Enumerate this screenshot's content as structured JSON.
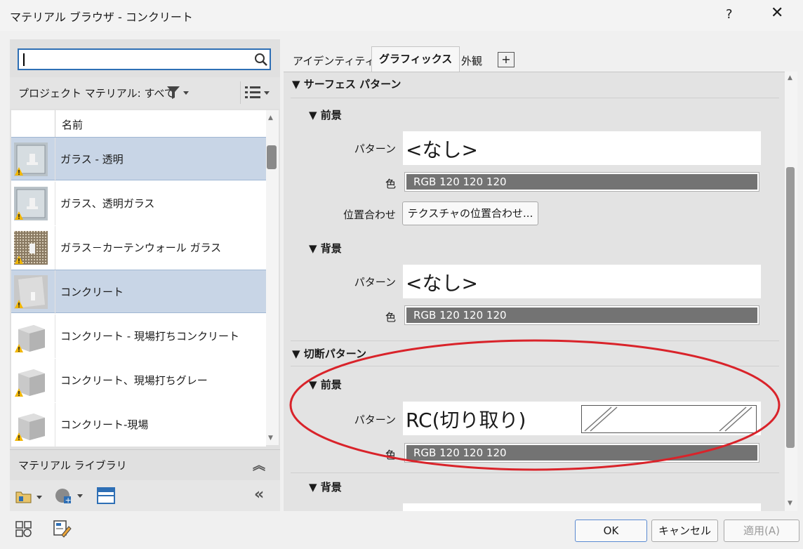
{
  "window": {
    "title": "マテリアル ブラウザ - コンクリート",
    "help": "?",
    "close": "✕"
  },
  "left": {
    "search": {
      "value": "",
      "placeholder": ""
    },
    "filter_label": "プロジェクト マテリアル: すべて",
    "list_header": "名前",
    "items": [
      {
        "label": "ガラス - 透明",
        "selected": true,
        "thumb": "glass-chair-thumbnail",
        "warning": true
      },
      {
        "label": "ガラス、透明ガラス",
        "selected": false,
        "thumb": "glass-chair-thumbnail",
        "warning": true
      },
      {
        "label": "ガラス－カーテンウォール ガラス",
        "selected": false,
        "thumb": "curtain-wall-thumbnail",
        "warning": true
      },
      {
        "label": "コンクリート",
        "selected": true,
        "thumb": "concrete-wall-thumbnail",
        "warning": true
      },
      {
        "label": "コンクリート - 現場打ちコンクリート",
        "selected": false,
        "thumb": "concrete-cube-thumbnail",
        "warning": true
      },
      {
        "label": "コンクリート、現場打ちグレー",
        "selected": false,
        "thumb": "concrete-cube-thumbnail",
        "warning": true
      },
      {
        "label": "コンクリート-現場",
        "selected": false,
        "thumb": "concrete-cube-thumbnail",
        "warning": true
      }
    ],
    "library_label": "マテリアル ライブラリ"
  },
  "tabs": [
    {
      "label": "アイデンティティ",
      "active": false
    },
    {
      "label": "グラフィックス",
      "active": true
    },
    {
      "label": "外観",
      "active": false
    }
  ],
  "add_tab": "+",
  "graphics": {
    "surface": {
      "title": "サーフェス パターン",
      "foreground": {
        "title": "前景",
        "pattern_label": "パターン",
        "pattern_value": "<なし>",
        "color_label": "色",
        "color_value": "RGB 120 120 120",
        "align_label": "位置合わせ",
        "align_button": "テクスチャの位置合わせ..."
      },
      "background": {
        "title": "背景",
        "pattern_label": "パターン",
        "pattern_value": "<なし>",
        "color_label": "色",
        "color_value": "RGB 120 120 120"
      }
    },
    "cut": {
      "title": "切断パターン",
      "foreground": {
        "title": "前景",
        "pattern_label": "パターン",
        "pattern_value": "RC(切り取り)",
        "color_label": "色",
        "color_value": "RGB 120 120 120"
      },
      "background": {
        "title": "背景"
      }
    }
  },
  "colors": {
    "swatch": "#787878",
    "highlight_ellipse": "#d9232a",
    "selection": "#c8d5e6"
  },
  "bottom": {
    "ok": "OK",
    "cancel": "キャンセル",
    "apply": "適用(A)"
  }
}
